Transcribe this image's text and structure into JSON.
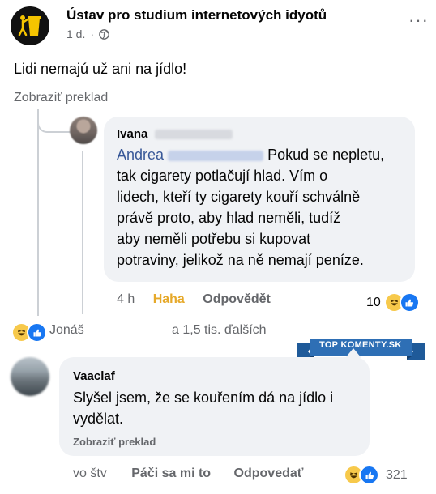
{
  "post": {
    "page_name": "Ústav pro studium internetových idyotů",
    "time": "1 d.",
    "separator": "·",
    "privacy_icon": "globe-icon",
    "more_icon": "more-icon",
    "more_label": "···",
    "text": "Lidi nemajú už ani na jídlo!",
    "translate_label": "Zobraziť preklad"
  },
  "reply": {
    "author": "Ivana",
    "mention": "Andrea",
    "text_line1": " Pokud se nepletu,",
    "text_lines": [
      "tak cigarety potlačují hlad. Vím o",
      "lidech, kteří ty cigarety kouří schválně",
      "právě proto, aby hlad neměli, tudíž",
      "aby neměli potřebu si kupovat",
      "potraviny, jelikož na ně nemají peníze."
    ],
    "time": "4 h",
    "reaction_label": "Haha",
    "reply_label": "Odpovědět",
    "reaction_count": "10",
    "react_icons": [
      "haha-icon",
      "like-icon"
    ]
  },
  "reactors": {
    "name": "Jonáš",
    "others": "a 1,5 tis. ďalších"
  },
  "watermark": {
    "text_top": "TOP",
    "text_bottom": "KOMENTY.SK",
    "accent": "#2e6fb5"
  },
  "comment": {
    "author": "Vaaclaf",
    "text_lines": [
      "Slyšel jsem, že se kouřením dá na jídlo i",
      "vydělat."
    ],
    "translate_label": "Zobraziť preklad",
    "time": "vo štv",
    "like_label": "Páči sa mi to",
    "reply_label": "Odpovedať",
    "reaction_count": "321"
  }
}
